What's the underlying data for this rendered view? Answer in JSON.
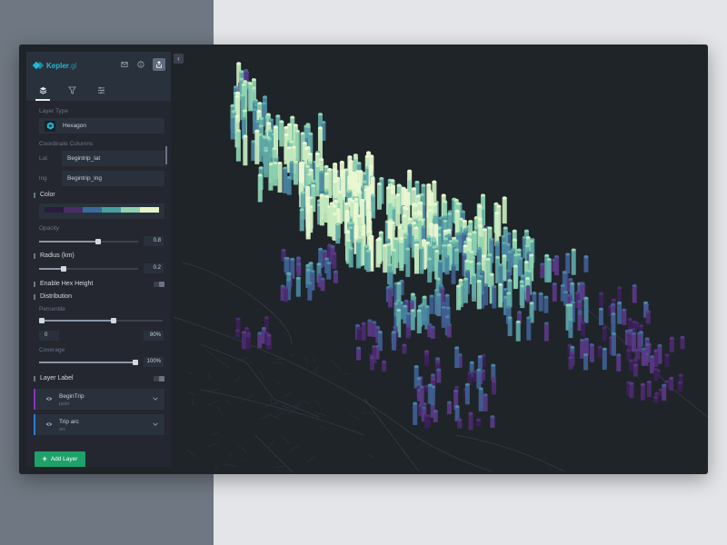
{
  "app": {
    "brand": "Kepler",
    "brand_suffix": ".gl",
    "colors": {
      "accent": "#1fbad6",
      "panel_bg": "#242730",
      "header_bg": "#29323c",
      "map_bg": "#1f2429",
      "add_button": "#1fa16a",
      "layer1_bar": "#8a2dc2",
      "layer2_bar": "#2d7ad6"
    },
    "header_icons": [
      "mail-icon",
      "info-icon",
      "share-icon"
    ],
    "tabs": [
      {
        "name": "layers-icon",
        "active": true
      },
      {
        "name": "filter-icon",
        "active": false
      },
      {
        "name": "settings-icon",
        "active": false
      }
    ]
  },
  "layer_config": {
    "layer_type_label": "Layer Type",
    "layer_type_value": "Hexagon",
    "coordinate_columns_label": "Coordinate Columns",
    "lat_label": "Lat",
    "lat_value": "Begintrip_lat",
    "lng_label": "lng",
    "lng_value": "Begintrip_lng",
    "color_title": "Color",
    "color_palette": [
      "#2a1b40",
      "#4a2d68",
      "#3a6a9a",
      "#4a9e9e",
      "#8fd1b0",
      "#e6f5c8"
    ],
    "opacity_label": "Opacity",
    "opacity_value": "0.8",
    "opacity_level": 0.6,
    "radius_title": "Radius (km)",
    "radius_value": "0.2",
    "radius_level": 0.25,
    "hex_height_title": "Enable Hex Height",
    "distribution_title": "Distribution",
    "percentile_label": "Percentile",
    "percentile_min": "0",
    "percentile_max": "80%",
    "percentile_level": 0.6,
    "coverage_label": "Coverage",
    "coverage_value": "100%",
    "coverage_level": 1.0,
    "layer_label_title": "Layer Label"
  },
  "layers": [
    {
      "name": "BeginTrip",
      "type": "point"
    },
    {
      "name": "Trip arc",
      "type": "arc"
    }
  ],
  "add_layer_label": "Add Layer"
}
